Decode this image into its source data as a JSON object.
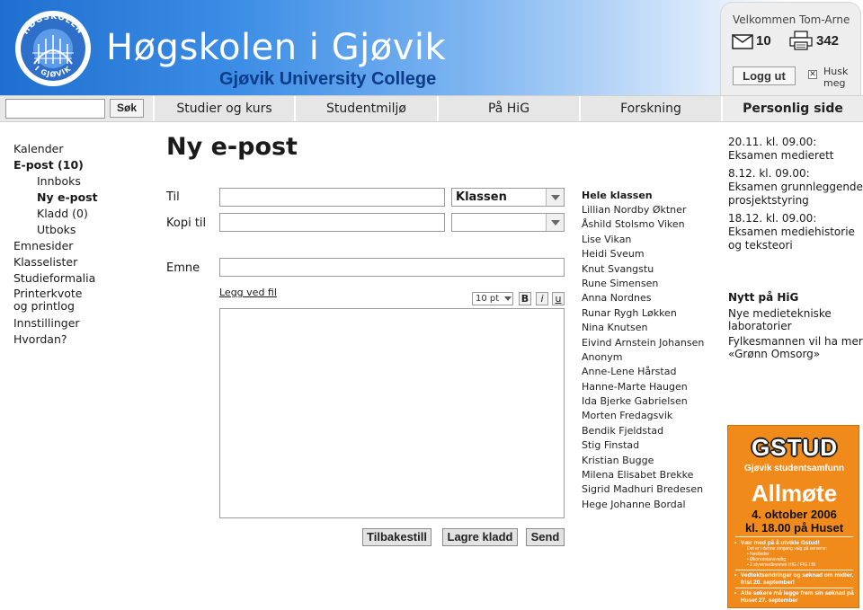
{
  "colors": {
    "brand_blue": "#1f6fd0",
    "navy": "#0d3b88",
    "poster_orange": "#f08a1a",
    "nav_bg": "#e9e9e9"
  },
  "header": {
    "logo_top_text": "HØGSKOLEN",
    "logo_bottom_text": "I GJØVIK",
    "title": "Høgskolen i Gjøvik",
    "subtitle": "Gjøvik University College"
  },
  "user": {
    "welcome": "Velkommen Tom-Arne",
    "mail_icon": "envelope-icon",
    "mail_count": "10",
    "print_icon": "printer-icon",
    "print_count": "342",
    "logout_label": "Logg ut",
    "remember_label": "Husk meg"
  },
  "search": {
    "value": "",
    "button_label": "Søk"
  },
  "nav": {
    "tabs": [
      {
        "label": "Studier og kurs"
      },
      {
        "label": "Studentmiljø"
      },
      {
        "label": "På HiG"
      },
      {
        "label": "Forskning"
      },
      {
        "label": "Personlig side"
      }
    ]
  },
  "sidebar": {
    "items": [
      {
        "label": "Kalender"
      },
      {
        "label": "E-post (10)"
      },
      {
        "label": "Innboks"
      },
      {
        "label": "Ny e-post"
      },
      {
        "label": "Kladd (0)"
      },
      {
        "label": "Utboks"
      },
      {
        "label": "Emnesider"
      },
      {
        "label": "Klasselister"
      },
      {
        "label": "Studieformalia"
      },
      {
        "label": "Printerkvote og printlog"
      },
      {
        "label": "Innstillinger"
      },
      {
        "label": "Hvordan?"
      }
    ]
  },
  "compose": {
    "title": "Ny e-post",
    "to_label": "Til",
    "cc_label": "Kopi til",
    "subject_label": "Emne",
    "to_value": "",
    "cc_value": "",
    "subject_value": "",
    "to_group_selected": "Klassen",
    "cc_group_selected": "",
    "attach_label": "Legg ved fil",
    "font_size": "10 pt",
    "bold_label": "B",
    "italic_label": "i",
    "underline_label": "u",
    "body_value": "",
    "reset_label": "Tilbakestill",
    "draft_label": "Lagre kladd",
    "send_label": "Send"
  },
  "recipients": {
    "header": "Hele klassen",
    "names": [
      "Lillian Nordby Øktner",
      "Åshild Stolsmo Viken",
      "Lise Vikan",
      "Heidi Sveum",
      "Knut Svangstu",
      "Rune Simensen",
      "Anna Nordnes",
      "Runar Rygh Løkken",
      "Nina Knutsen",
      "Eivind Arnstein Johansen",
      "Anonym",
      "Anne-Lene Hårstad",
      "Hanne-Marte Haugen",
      "Ida Bjerke Gabrielsen",
      "Morten Fredagsvik",
      "Bendik Fjeldstad",
      "Stig Finstad",
      "Kristian Bugge",
      "Milena Elisabet Brekke",
      "Sigrid Madhuri Bredesen",
      "Hege Johanne Bordal"
    ]
  },
  "events": [
    {
      "date": "20.11. kl. 09.00:",
      "text": "Eksamen medierett"
    },
    {
      "date": "8.12. kl. 09.00:",
      "text": "Eksamen grunnleggende prosjektstyring"
    },
    {
      "date": "18.12. kl. 09.00:",
      "text": "Eksamen mediehistorie og teksteori"
    }
  ],
  "news": {
    "heading": "Nytt på HiG",
    "items": [
      {
        "text": "Nye medietekniske laboratorier"
      },
      {
        "text": "Fylkesmannen vil ha mer «Grønn Omsorg»"
      }
    ]
  },
  "poster": {
    "logo": "GSTUD",
    "org": "Gjøvik studentsamfunn",
    "title": "Allmøte",
    "date": "4. oktober 2006",
    "time": "kl. 18.00 på Huset",
    "bullet1": "Vær med på å utvikle Gstud!",
    "bullet1_sub1": "Det er i denne omgang valg på vervene:",
    "bullet1_sub2": "• Nestleder",
    "bullet1_sub3": "• Økonomiansvarlig",
    "bullet1_sub4": "• 2 styremedlemmer HIG / FIG / BI",
    "bullet2": "Vedtektsendringer og søknad om midler, frist 20. september!",
    "bullet3": "Alle søkere må legge frem sin søknad på Huset 27. september"
  }
}
